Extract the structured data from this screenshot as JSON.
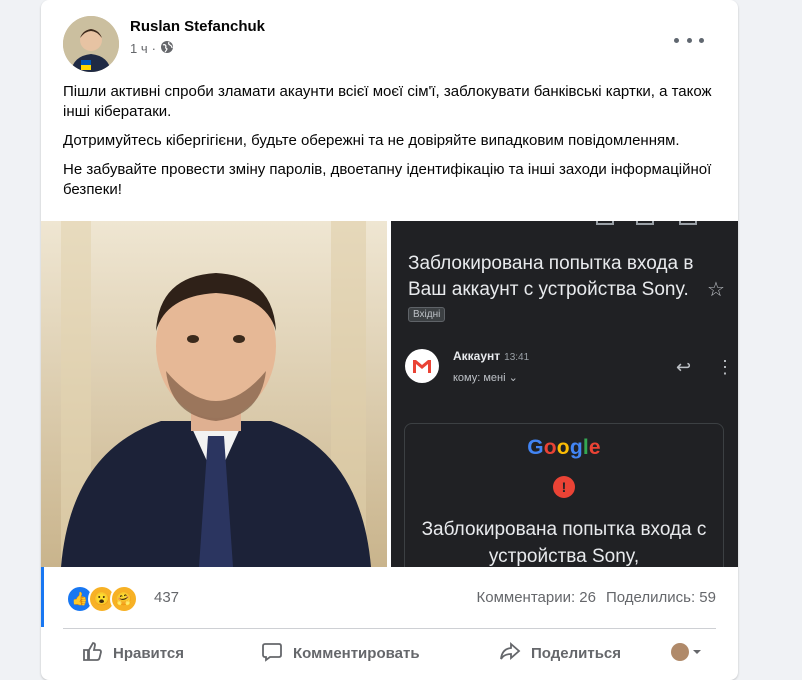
{
  "post": {
    "author": "Ruslan Stefanchuk",
    "time": "1 ч",
    "dot": "·",
    "paragraphs": [
      "Пішли активні спроби зламати акаунти всієї моєї сім'ї, заблокувати банківські картки, а також інші кібератаки.",
      "Дотримуйтесь кібергігієни, будьте обережні та не довіряйте випадковим повідомленням.",
      "Не забувайте провести зміну паролів, двоетапну ідентифікацію та інші заходи інформаційної безпеки!"
    ]
  },
  "email": {
    "subject": "Заблокирована попытка входа в Ваш аккаунт с устройства Sony.",
    "tag": "Вхідні",
    "sender": "Аккаунт",
    "time": "13:41",
    "to": "кому: мені ⌄",
    "google": [
      "G",
      "o",
      "o",
      "g",
      "l",
      "e"
    ],
    "alert": "!",
    "blocked_text": "Заблокирована попытка входа с устройства Sony,"
  },
  "reactions": {
    "count": "437",
    "comments": "Комментарии: 26",
    "shares": "Поделились: 59"
  },
  "actions": {
    "like": "Нравится",
    "comment": "Комментировать",
    "share": "Поделиться"
  },
  "colors": {
    "accent": "#1877f2",
    "secondary_text": "#65676b"
  }
}
